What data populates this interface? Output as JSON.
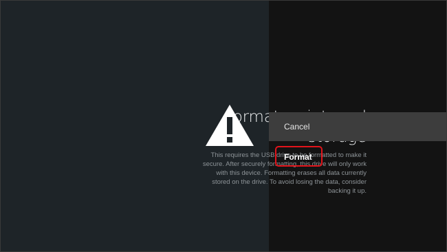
{
  "dialog": {
    "title_line1": "Format as internal",
    "title_line2": "storage",
    "description_lines": [
      "This requires the USB drive to be formatted to make it",
      "secure. After securely formatting, this drive will only work",
      "with this device. Formatting erases all data currently",
      "stored on the drive. To avoid losing the data, consider",
      "backing it up."
    ],
    "icon": "warning-icon"
  },
  "actions": {
    "cancel_label": "Cancel",
    "format_label": "Format"
  },
  "colors": {
    "left_panel": "#1e2428",
    "right_panel": "#131313",
    "selected_item": "#3d3d3d",
    "highlight": "#e3141b"
  }
}
